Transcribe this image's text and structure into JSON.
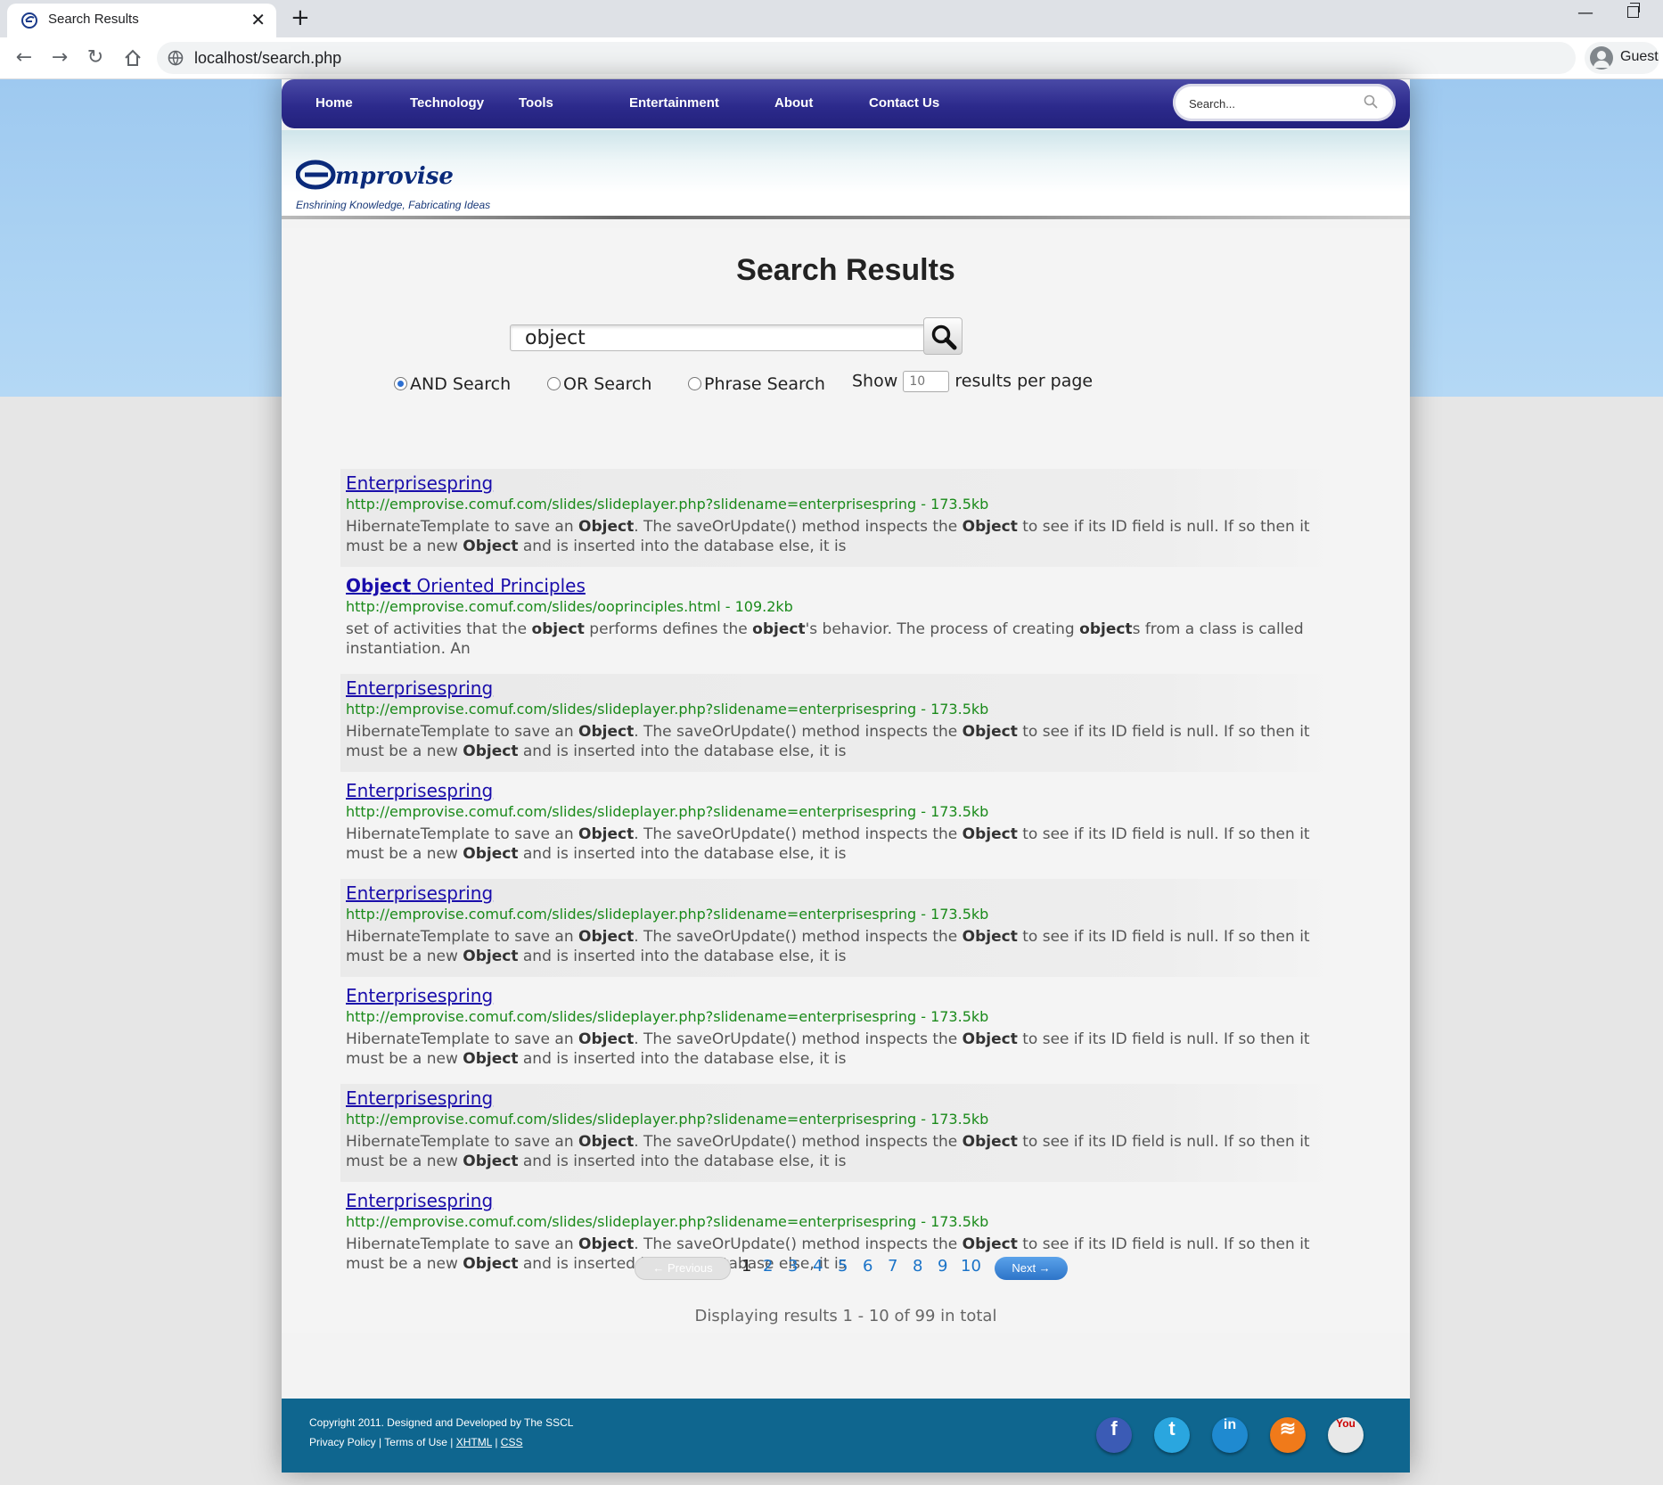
{
  "browser": {
    "tab_title": "Search Results",
    "tab_close": "✕",
    "new_tab": "+",
    "address": "localhost/search.php",
    "profile": "Guest"
  },
  "nav": {
    "items": [
      "Home",
      "Technology",
      "Tools",
      "Entertainment",
      "About",
      "Contact Us"
    ],
    "search_placeholder": "Search..."
  },
  "header": {
    "logo_text": "mprovise",
    "tagline": "Enshrining Knowledge, Fabricating Ideas"
  },
  "search": {
    "title": "Search Results",
    "query": "object",
    "options": {
      "and_label": "AND Search",
      "or_label": "OR Search",
      "phrase_label": "Phrase Search",
      "selected": "and",
      "show_label": "Show",
      "per_page_placeholder": "10",
      "per_page_suffix": "results per page"
    }
  },
  "results": [
    {
      "title_parts": [
        [
          "",
          "Enterprisespring"
        ]
      ],
      "url": "http://emprovise.comuf.com/slides/slideplayer.php?slidename=enterprisespring - 173.5kb",
      "snippet": [
        [
          "HibernateTemplate to save an ",
          ""
        ],
        [
          "Object",
          "b"
        ],
        [
          ". The saveOrUpdate() method inspects the ",
          ""
        ],
        [
          "Object",
          "b"
        ],
        [
          " to see if its ID field is null. If so then it must be a new ",
          ""
        ],
        [
          "Object",
          "b"
        ],
        [
          " and is inserted into the database else, it is",
          ""
        ]
      ]
    },
    {
      "title_parts": [
        [
          "b",
          "Object"
        ],
        [
          "",
          " Oriented Principles"
        ]
      ],
      "url": "http://emprovise.comuf.com/slides/ooprinciples.html - 109.2kb",
      "snippet": [
        [
          "set of activities that the ",
          ""
        ],
        [
          "object",
          "b"
        ],
        [
          " performs defines the ",
          ""
        ],
        [
          "object",
          "b"
        ],
        [
          "'s behavior. The process of creating ",
          ""
        ],
        [
          "object",
          "b"
        ],
        [
          "s from a class is called instantiation. An",
          ""
        ]
      ]
    },
    {
      "title_parts": [
        [
          "",
          "Enterprisespring"
        ]
      ],
      "url": "http://emprovise.comuf.com/slides/slideplayer.php?slidename=enterprisespring - 173.5kb",
      "snippet": [
        [
          "HibernateTemplate to save an ",
          ""
        ],
        [
          "Object",
          "b"
        ],
        [
          ". The saveOrUpdate() method inspects the ",
          ""
        ],
        [
          "Object",
          "b"
        ],
        [
          " to see if its ID field is null. If so then it must be a new ",
          ""
        ],
        [
          "Object",
          "b"
        ],
        [
          " and is inserted into the database else, it is",
          ""
        ]
      ]
    },
    {
      "title_parts": [
        [
          "",
          "Enterprisespring"
        ]
      ],
      "url": "http://emprovise.comuf.com/slides/slideplayer.php?slidename=enterprisespring - 173.5kb",
      "snippet": [
        [
          "HibernateTemplate to save an ",
          ""
        ],
        [
          "Object",
          "b"
        ],
        [
          ". The saveOrUpdate() method inspects the ",
          ""
        ],
        [
          "Object",
          "b"
        ],
        [
          " to see if its ID field is null. If so then it must be a new ",
          ""
        ],
        [
          "Object",
          "b"
        ],
        [
          " and is inserted into the database else, it is",
          ""
        ]
      ]
    },
    {
      "title_parts": [
        [
          "",
          "Enterprisespring"
        ]
      ],
      "url": "http://emprovise.comuf.com/slides/slideplayer.php?slidename=enterprisespring - 173.5kb",
      "snippet": [
        [
          "HibernateTemplate to save an ",
          ""
        ],
        [
          "Object",
          "b"
        ],
        [
          ". The saveOrUpdate() method inspects the ",
          ""
        ],
        [
          "Object",
          "b"
        ],
        [
          " to see if its ID field is null. If so then it must be a new ",
          ""
        ],
        [
          "Object",
          "b"
        ],
        [
          " and is inserted into the database else, it is",
          ""
        ]
      ]
    },
    {
      "title_parts": [
        [
          "",
          "Enterprisespring"
        ]
      ],
      "url": "http://emprovise.comuf.com/slides/slideplayer.php?slidename=enterprisespring - 173.5kb",
      "snippet": [
        [
          "HibernateTemplate to save an ",
          ""
        ],
        [
          "Object",
          "b"
        ],
        [
          ". The saveOrUpdate() method inspects the ",
          ""
        ],
        [
          "Object",
          "b"
        ],
        [
          " to see if its ID field is null. If so then it must be a new ",
          ""
        ],
        [
          "Object",
          "b"
        ],
        [
          " and is inserted into the database else, it is",
          ""
        ]
      ]
    },
    {
      "title_parts": [
        [
          "",
          "Enterprisespring"
        ]
      ],
      "url": "http://emprovise.comuf.com/slides/slideplayer.php?slidename=enterprisespring - 173.5kb",
      "snippet": [
        [
          "HibernateTemplate to save an ",
          ""
        ],
        [
          "Object",
          "b"
        ],
        [
          ". The saveOrUpdate() method inspects the ",
          ""
        ],
        [
          "Object",
          "b"
        ],
        [
          " to see if its ID field is null. If so then it must be a new ",
          ""
        ],
        [
          "Object",
          "b"
        ],
        [
          " and is inserted into the database else, it is",
          ""
        ]
      ]
    },
    {
      "title_parts": [
        [
          "",
          "Enterprisespring"
        ]
      ],
      "url": "http://emprovise.comuf.com/slides/slideplayer.php?slidename=enterprisespring - 173.5kb",
      "snippet": [
        [
          "HibernateTemplate to save an ",
          ""
        ],
        [
          "Object",
          "b"
        ],
        [
          ". The saveOrUpdate() method inspects the ",
          ""
        ],
        [
          "Object",
          "b"
        ],
        [
          " to see if its ID field is null. If so then it must be a new ",
          ""
        ],
        [
          "Object",
          "b"
        ],
        [
          " and is inserted into the database else, it is",
          ""
        ]
      ]
    }
  ],
  "pagination": {
    "prev_label": "← Previous",
    "pages": [
      "1",
      "2",
      "3",
      "4",
      "5",
      "6",
      "7",
      "8",
      "9",
      "10"
    ],
    "current": "1",
    "next_label": "Next →",
    "summary": "Displaying results 1 - 10 of 99 in total"
  },
  "footer": {
    "copyright": "Copyright 2011. Designed and Developed by The SSCL",
    "privacy": "Privacy Policy",
    "sep": " | ",
    "terms": "Terms of Use",
    "xhtml": "XHTML",
    "css": "CSS",
    "social": [
      {
        "icon": "facebook-icon",
        "glyph": "f",
        "color": "#3b5bb5"
      },
      {
        "icon": "twitter-icon",
        "glyph": "t",
        "color": "#2aa6df"
      },
      {
        "icon": "linkedin-icon",
        "glyph": "in",
        "color": "#1f8ad0"
      },
      {
        "icon": "rss-icon",
        "glyph": "≋",
        "color": "#f07a1a"
      },
      {
        "icon": "youtube-icon",
        "glyph": "You",
        "color": "#e8e8e8"
      }
    ]
  },
  "colors": {
    "nav_bg": "#2c2a8c",
    "link": "#1a0dab",
    "url_green": "#1a8a1a",
    "footer_bg": "#0f668f"
  }
}
